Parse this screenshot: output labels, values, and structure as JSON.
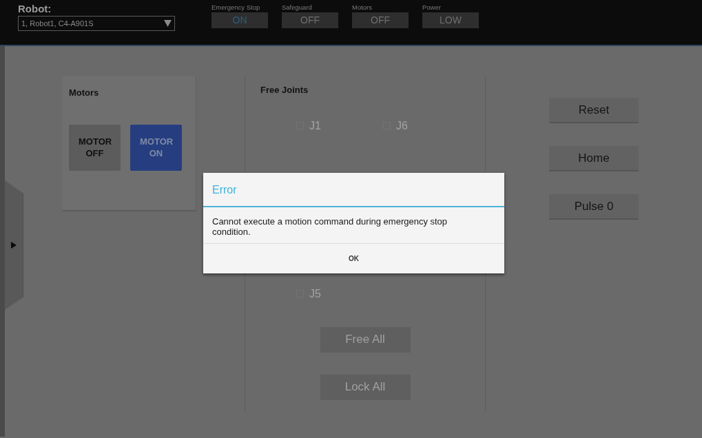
{
  "robot": {
    "label": "Robot:",
    "value": "1, Robot1, C4-A901S"
  },
  "status": [
    {
      "label": "Emergency Stop",
      "value": "ON",
      "active": true
    },
    {
      "label": "Safeguard",
      "value": "OFF",
      "active": false
    },
    {
      "label": "Motors",
      "value": "OFF",
      "active": false
    },
    {
      "label": "Power",
      "value": "LOW",
      "active": false
    }
  ],
  "motors": {
    "title": "Motors",
    "buttons": [
      {
        "label": "MOTOR OFF",
        "selected": false
      },
      {
        "label": "MOTOR ON",
        "selected": true
      }
    ]
  },
  "free_joints": {
    "title": "Free Joints",
    "columns": [
      [
        {
          "label": "J1",
          "checked": false
        },
        {
          "label": "J5",
          "checked": false
        }
      ],
      [
        {
          "label": "J6",
          "checked": false
        }
      ]
    ],
    "buttons": [
      {
        "label": "Free All",
        "disabled": true
      },
      {
        "label": "Lock All",
        "disabled": true
      }
    ]
  },
  "actions": [
    "Reset",
    "Home",
    "Pulse 0"
  ],
  "dialog": {
    "title": "Error",
    "message": "Cannot execute a motion command during emergency stop condition.",
    "button": "OK"
  }
}
